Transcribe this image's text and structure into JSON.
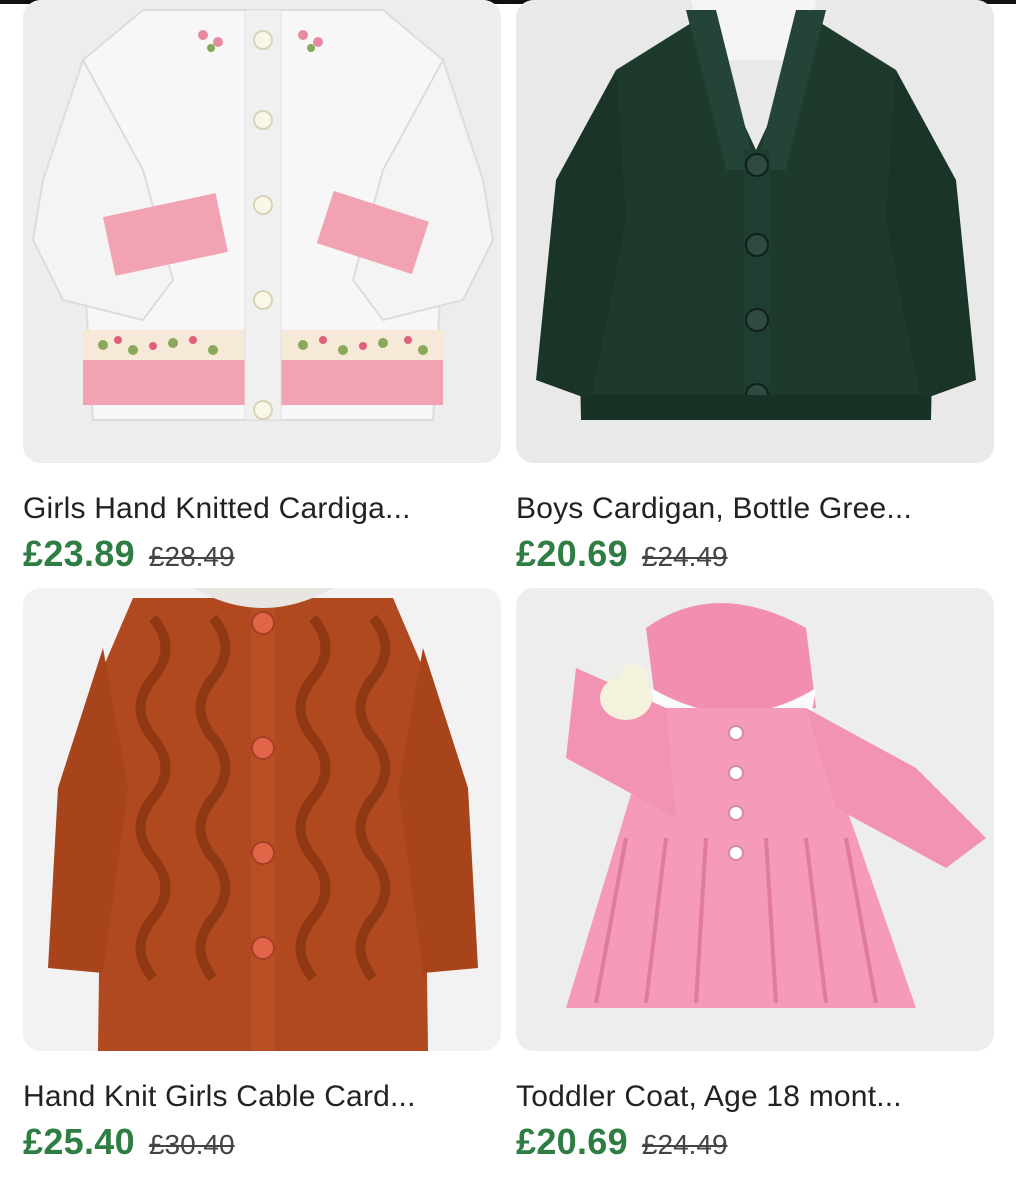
{
  "listings": [
    {
      "title": "Girls Hand Knitted Cardiga...",
      "price": "£23.89",
      "original_price": "£28.49",
      "image": "white-cardigan-pink-bands"
    },
    {
      "title": "Boys Cardigan, Bottle Gree...",
      "price": "£20.69",
      "original_price": "£24.49",
      "image": "bottle-green-shawl-cardigan"
    },
    {
      "title": "Hand Knit Girls Cable Card...",
      "price": "£25.40",
      "original_price": "£30.40",
      "image": "rust-cable-cardigan"
    },
    {
      "title": "Toddler Coat, Age 18 mont...",
      "price": "£20.69",
      "original_price": "£24.49",
      "image": "pink-toddler-coat"
    }
  ],
  "colors": {
    "sale_price": "#2e7d43",
    "title_text": "#222222",
    "struck_price": "#444444"
  }
}
